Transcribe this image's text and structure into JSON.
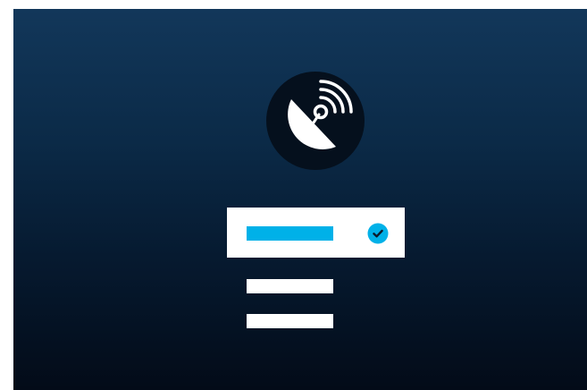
{
  "scene": {
    "background_top": "#12375a",
    "background_bottom": "#030b18"
  },
  "badge": {
    "icon": "satellite-dish-icon",
    "circle_color": "#05101d",
    "glyph_color": "#ffffff"
  },
  "menu": {
    "items": [
      {
        "state": "selected",
        "bar_color": "#00b1e8",
        "icon": "check-circle-icon",
        "icon_color": "#00b1e8"
      },
      {
        "state": "default",
        "bar_color": "#ffffff"
      },
      {
        "state": "default",
        "bar_color": "#ffffff"
      }
    ]
  }
}
